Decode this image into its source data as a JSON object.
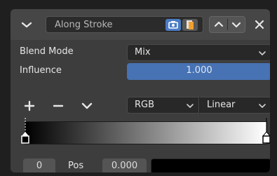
{
  "header": {
    "modifier_name": "Along Stroke"
  },
  "properties": {
    "blend_mode_label": "Blend Mode",
    "blend_mode_value": "Mix",
    "influence_label": "Influence",
    "influence_value": "1.000"
  },
  "color_ramp": {
    "color_mode": "RGB",
    "interpolation": "Linear",
    "gradient_start": "#000000",
    "gradient_end": "#ffffff",
    "active_stop_index": "0",
    "pos_label": "Pos",
    "pos_value": "0.000",
    "active_stop_color": "#000000"
  },
  "colors": {
    "accent": "#4772b3",
    "panel": "#3d3d3d",
    "header": "#464646"
  }
}
